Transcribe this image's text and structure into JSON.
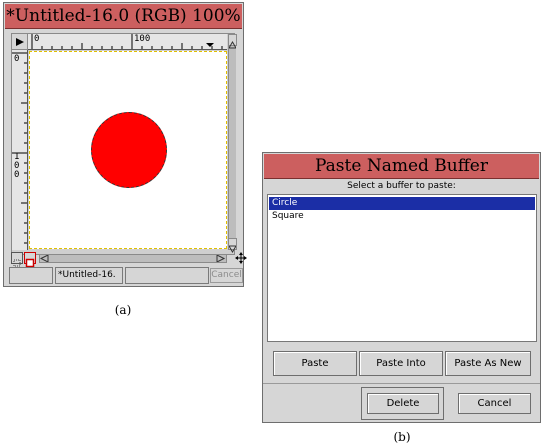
{
  "window_a": {
    "title": "*Untitled-16.0 (RGB) 100%",
    "ruler_h_labels": [
      "0",
      "100"
    ],
    "ruler_v_labels": [
      "0",
      "1",
      "0",
      "0"
    ],
    "status_filename": "*Untitled-16.",
    "cancel_label": "Cancel",
    "circle_color": "#ff0000",
    "caption": "(a)"
  },
  "window_b": {
    "title": "Paste Named Buffer",
    "prompt": "Select a buffer to paste:",
    "buffers": [
      {
        "label": "Circle",
        "selected": true
      },
      {
        "label": "Square",
        "selected": false
      }
    ],
    "buttons": {
      "paste": "Paste",
      "paste_into": "Paste Into",
      "paste_as_new": "Paste As New",
      "delete": "Delete",
      "cancel": "Cancel"
    },
    "caption": "(b)"
  },
  "colors": {
    "title_bar": "#cc5f5f",
    "selection": "#1b2ea6",
    "window_bg": "#d6d6d6"
  }
}
